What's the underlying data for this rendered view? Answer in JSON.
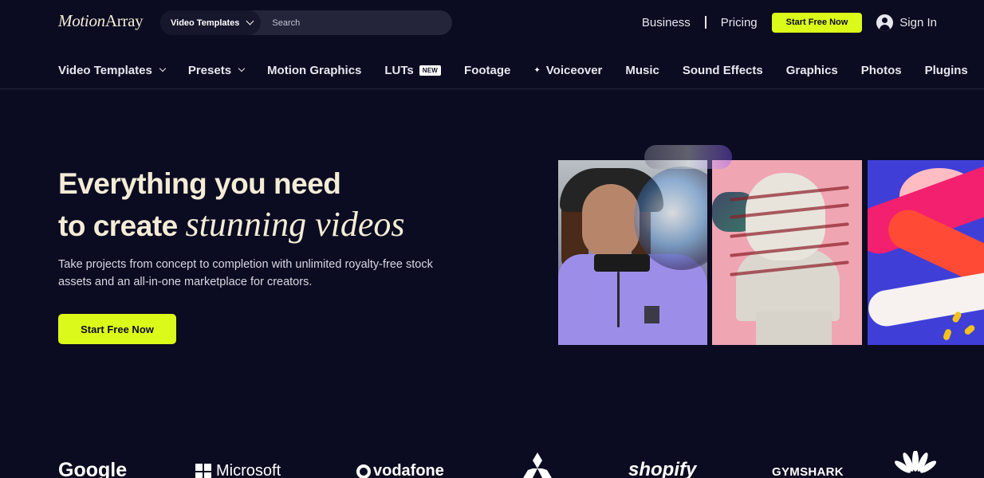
{
  "header": {
    "logo": {
      "first": "Motion",
      "second": "Array"
    },
    "search": {
      "category": "Video Templates",
      "placeholder": "Search"
    },
    "links": [
      "Business",
      "Pricing"
    ],
    "cta": "Start Free Now",
    "signin": "Sign In"
  },
  "nav": {
    "items": [
      {
        "label": "Video Templates",
        "dropdown": true
      },
      {
        "label": "Presets",
        "dropdown": true
      },
      {
        "label": "Motion Graphics"
      },
      {
        "label": "LUTs",
        "badge": "NEW"
      },
      {
        "label": "Footage"
      },
      {
        "label": "Voiceover",
        "icon": "sparkle-icon"
      },
      {
        "label": "Music"
      },
      {
        "label": "Sound Effects"
      },
      {
        "label": "Graphics"
      },
      {
        "label": "Photos"
      },
      {
        "label": "Plugins"
      }
    ]
  },
  "hero": {
    "line1": "Everything you need",
    "line2_plain": "to create ",
    "line2_italic": "stunning videos",
    "description": "Take projects from concept to completion with unlimited royalty-free stock assets and an all-in-one marketplace for creators.",
    "cta": "Start Free Now"
  },
  "logos": {
    "google": "Google",
    "microsoft": "Microsoft",
    "vodafone": "vodafone",
    "shopify": "shopify",
    "gymshark": "GYMSHARK"
  },
  "colors": {
    "background": "#0b0b21",
    "accent": "#dcfa1a",
    "heading": "#f4ecd6"
  }
}
